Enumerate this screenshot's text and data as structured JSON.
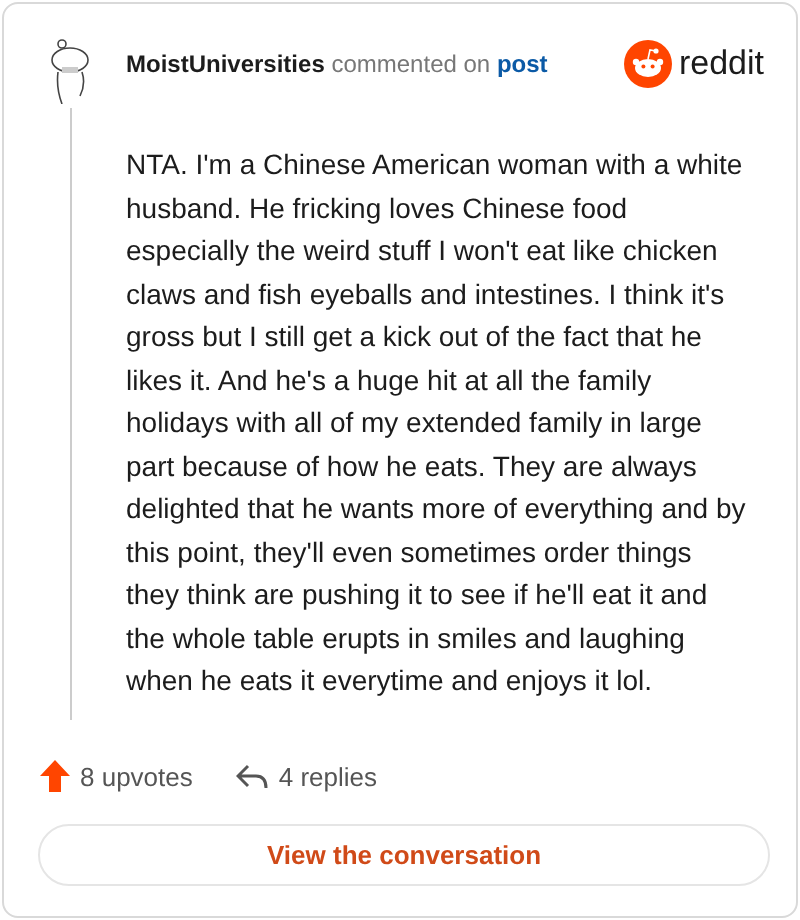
{
  "comment": {
    "author": "MoistUniversities",
    "action": "commented on",
    "link": "post",
    "brand": "reddit",
    "body": "NTA. I'm a Chinese American woman with a white husband. He fricking loves Chinese food especially the weird stuff I won't eat like chicken claws and fish eyeballs and intestines. I think it's gross but I still get a kick out of the fact that he likes it. And he's a huge hit at all the family holidays with all of my extended family in large part because of how he eats. They are always delighted that he wants more of everything and by this point, they'll even sometimes order things they think are pushing it to see if he'll eat it and the whole table erupts in smiles and laughing when he eats it everytime and enjoys it lol."
  },
  "stats": {
    "upvotes": "8 upvotes",
    "replies": "4 replies"
  },
  "button": "View the conversation"
}
